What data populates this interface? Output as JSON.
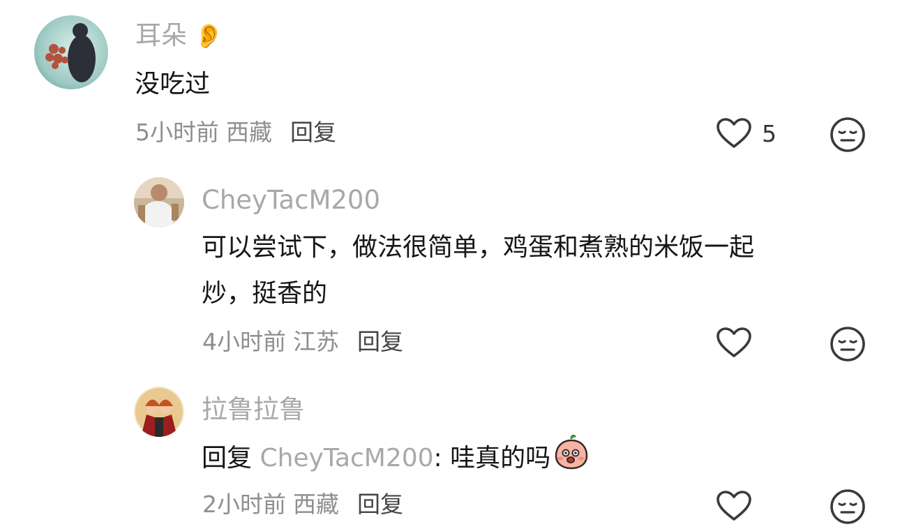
{
  "comments": [
    {
      "username": "耳朵",
      "text": "没吃过",
      "time": "5小时前",
      "location": "西藏",
      "reply_label": "回复",
      "like_count": "5"
    },
    {
      "username": "CheyTacM200",
      "text_line1": "可以尝试下，做法很简单，鸡蛋和煮熟的米饭一起",
      "text_line2": "炒，挺香的",
      "time": "4小时前",
      "location": "江苏",
      "reply_label": "回复",
      "like_count": ""
    },
    {
      "username": "拉鲁拉鲁",
      "reply_prefix": "回复",
      "reply_to": "CheyTacM200",
      "text": ": 哇真的吗",
      "time": "2小时前",
      "location": "西藏",
      "reply_label": "回复",
      "like_count": ""
    }
  ],
  "icons": {
    "ear_emoji": "👂",
    "like": "heart-outline-icon",
    "dislike": "meh-face-icon",
    "sticker": "peach-sticker-icon"
  },
  "colors": {
    "username": "#a8a8a8",
    "text": "#161616",
    "meta": "#8e8e8e",
    "icon": "#3a3a3a"
  }
}
